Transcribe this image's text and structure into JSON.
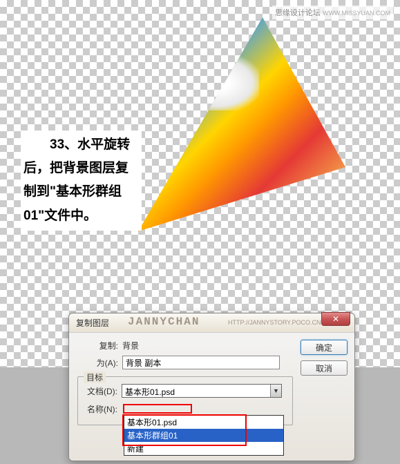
{
  "watermark": {
    "forum": "思缘设计论坛",
    "url": "WWW.MISSYUAN.COM"
  },
  "instruction": "　　33、水平旋转后，把背景图层复制到\"基本形群组01\"文件中。",
  "dialog": {
    "title": "复制图层",
    "watermark": "JANNYCHAN",
    "watermark_url": "HTTP://JANNYSTORY.POCO.CN",
    "copy_label": "复制:",
    "copy_value": "背景",
    "as_label": "为(A):",
    "as_value": "背景 副本",
    "target_label": "目标",
    "doc_label": "文档(D):",
    "doc_value": "基本形01.psd",
    "name_label": "名称(N):",
    "dropdown": {
      "option1": "基本形01.psd",
      "option2_selected": "基本形群组01",
      "option3": "新建"
    },
    "ok": "确定",
    "cancel": "取消"
  }
}
